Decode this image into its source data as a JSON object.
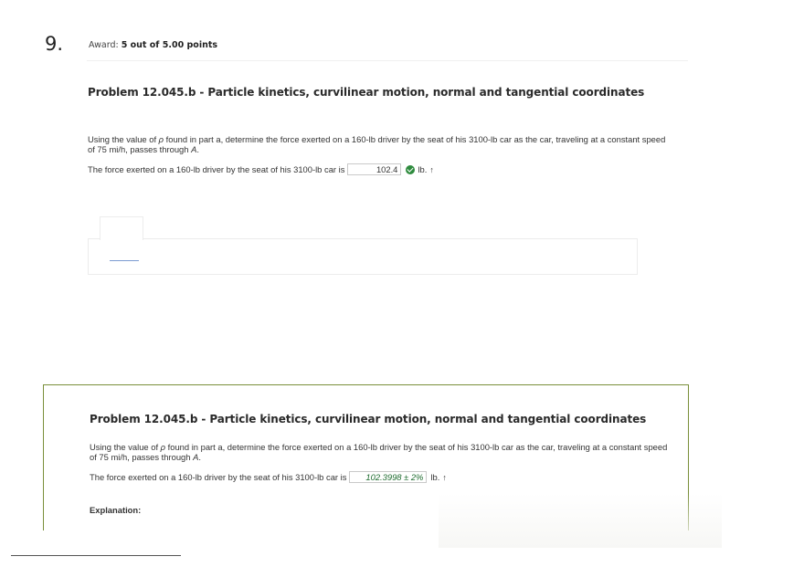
{
  "question": {
    "number": "9.",
    "award_label": "Award:",
    "award_value": "5 out of 5.00 points"
  },
  "problem": {
    "title": "Problem 12.045.b - Particle kinetics, curvilinear motion, normal and tangential coordinates",
    "prompt_pre": "Using the value of ",
    "prompt_rho": "ρ",
    "prompt_mid": " found in part a, determine the force exerted on a 160-lb driver by the seat of his 3100-lb car as the car, traveling at a constant speed of 75 mi/h, passes through ",
    "prompt_A": "A",
    "prompt_end": ".",
    "answer_label": "The force exerted on a 160-lb driver by the seat of his 3100-lb car is",
    "answer_value": "102.4",
    "answer_unit": "lb.",
    "answer_direction": "↑"
  },
  "solution": {
    "title": "Problem 12.045.b - Particle kinetics, curvilinear motion, normal and tangential coordinates",
    "prompt_pre": "Using the value of ",
    "prompt_rho": "ρ",
    "prompt_mid": " found in part a, determine the force exerted on a 160-lb driver by the seat of his 3100-lb car as the car, traveling at a constant speed of 75 mi/h, passes through ",
    "prompt_A": "A",
    "prompt_end": ".",
    "answer_label": "The force exerted on a 160-lb driver by the seat of his 3100-lb car is",
    "answer_value": "102.3998 ± 2%",
    "answer_unit": "lb.",
    "answer_direction": "↑",
    "explanation_label": "Explanation:"
  },
  "colors": {
    "correct_check": "#2e8b3e",
    "solution_border": "#7a8f3a",
    "solution_answer": "#1d6b2e"
  }
}
